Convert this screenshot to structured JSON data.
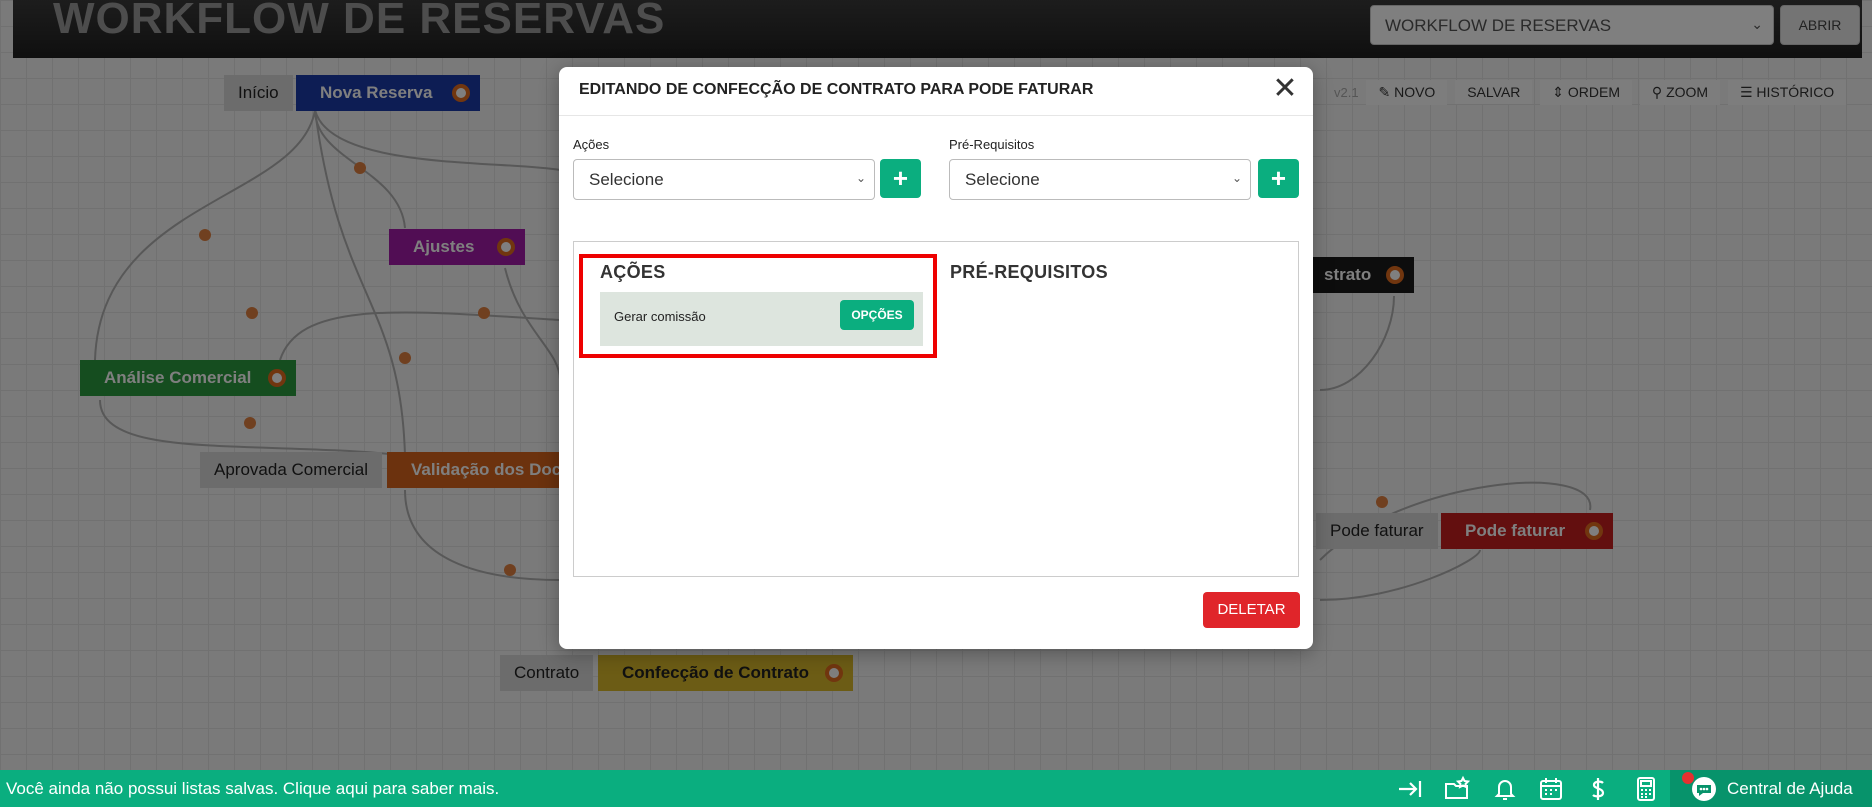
{
  "background": {
    "app_title": "WORKFLOW DE RESERVAS",
    "workflow_select": {
      "value": "WORKFLOW DE RESERVAS"
    },
    "open_button": "ABRIR",
    "version": "v2.1",
    "toolbar": {
      "new": "NOVO",
      "save": "SALVAR",
      "order": "ORDEM",
      "zoom": "ZOOM",
      "history": "HISTÓRICO"
    },
    "nodes": {
      "start": "Início",
      "new_reservation": "Nova Reserva",
      "adjustments": "Ajustes",
      "commercial_analysis": "Análise Comercial",
      "approved_commercial": "Aprovada Comercial",
      "doc_validation": "Validação dos Doc",
      "contract_partial": "strato",
      "can_invoice_tag": "Pode faturar",
      "can_invoice": "Pode faturar",
      "contract_tag": "Contrato",
      "contract_making": "Confecção de Contrato"
    },
    "colors": {
      "blue": "#1b3aa8",
      "purple": "#a31aa8",
      "green": "#2a9a3e",
      "orange": "#d9651c",
      "red": "#c71f1f",
      "yellow": "#d9b82b",
      "black": "#1a1a1a"
    }
  },
  "modal": {
    "title": "EDITANDO DE CONFECÇÃO DE CONTRATO PARA PODE FATURAR",
    "actions_label": "Ações",
    "actions_select": "Selecione",
    "prereq_label": "Pré-Requisitos",
    "prereq_select": "Selecione",
    "actions_heading": "AÇÕES",
    "prereq_heading": "PRÉ-REQUISITOS",
    "actions_items": [
      {
        "label": "Gerar comissão",
        "options_label": "OPÇÕES"
      }
    ],
    "delete_label": "DELETAR",
    "accent": "#0bae7f",
    "danger": "#e0252a"
  },
  "bottom_bar": {
    "message": "Você ainda não possui listas salvas. Clique aqui para saber mais.",
    "help_label": "Central de Ajuda",
    "icons": [
      "collapse-arrow-icon",
      "star-folder-icon",
      "bell-icon",
      "calendar-icon",
      "dollar-icon",
      "calculator-icon",
      "chat-icon"
    ]
  }
}
